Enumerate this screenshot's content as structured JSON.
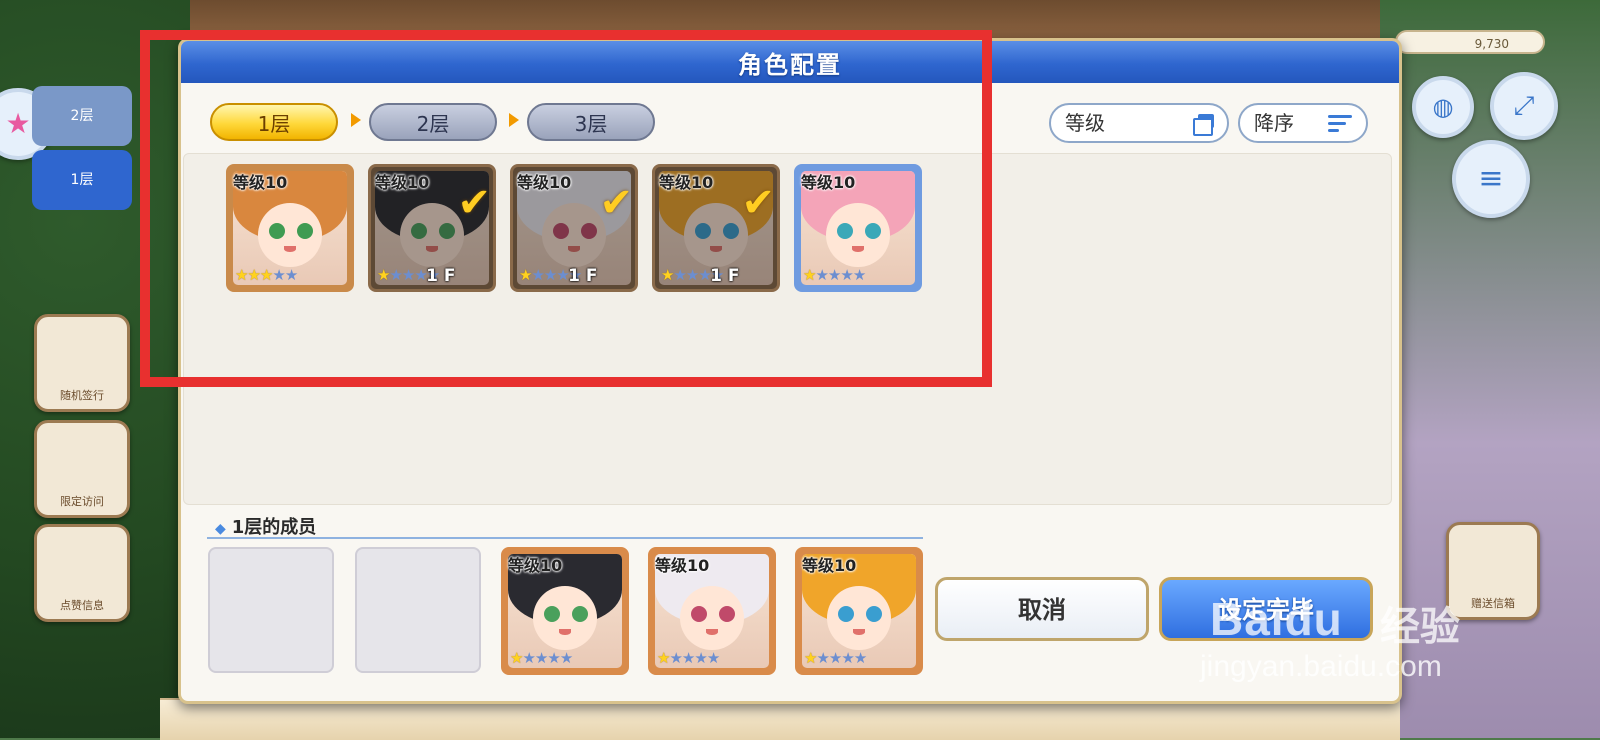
{
  "dialog": {
    "title": "角色配置",
    "floor_tabs": [
      {
        "label": "1层",
        "active": true
      },
      {
        "label": "2层",
        "active": false
      },
      {
        "label": "3层",
        "active": false
      }
    ],
    "sort_level_label": "等级",
    "sort_order_label": "降序"
  },
  "characters": [
    {
      "level": "等级10",
      "stars": 3,
      "floor": "",
      "checked": false,
      "hair": "#d9873e",
      "eyes": "#3f9b52",
      "frame": "#c98a4a"
    },
    {
      "level": "等级10",
      "stars": 1,
      "floor": "1 F",
      "checked": true,
      "hair": "#2a2a30",
      "eyes": "#4aa05c",
      "frame": "#8a6a4a"
    },
    {
      "level": "等级10",
      "stars": 1,
      "floor": "1 F",
      "checked": true,
      "hair": "#eeeaf0",
      "eyes": "#c04a6a",
      "frame": "#8a6a4a"
    },
    {
      "level": "等级10",
      "stars": 1,
      "floor": "1 F",
      "checked": true,
      "hair": "#f0a52a",
      "eyes": "#3a9ed0",
      "frame": "#8a6a4a"
    },
    {
      "level": "等级10",
      "stars": 1,
      "floor": "",
      "checked": false,
      "hair": "#f4a4b8",
      "eyes": "#3aa8b8",
      "frame": "#6f9be0"
    }
  ],
  "members": {
    "title": "1层的成员",
    "slots": [
      {
        "level": "等级10",
        "stars": 1,
        "hair": "#2a2a30",
        "eyes": "#4aa05c"
      },
      {
        "level": "等级10",
        "stars": 1,
        "hair": "#eeeaf0",
        "eyes": "#c04a6a"
      },
      {
        "level": "等级10",
        "stars": 1,
        "hair": "#f0a52a",
        "eyes": "#3a9ed0"
      }
    ]
  },
  "buttons": {
    "cancel": "取消",
    "confirm": "设定完毕"
  },
  "background": {
    "side_tabs": [
      "2层",
      "1层"
    ],
    "side_buttons": [
      "随机签行",
      "限定访问",
      "点赞信息"
    ],
    "right_button": "赠送信箱",
    "coin_value": "9,730"
  },
  "watermark": {
    "brand": "Baidu",
    "suffix": "经验",
    "url": "jingyan.baidu.com"
  },
  "colors": {
    "header_blue": "#2f66cf",
    "active_tab_gold": "#ffd83a",
    "highlight_red": "#e8302f",
    "confirm_blue": "#2f6fe0"
  }
}
